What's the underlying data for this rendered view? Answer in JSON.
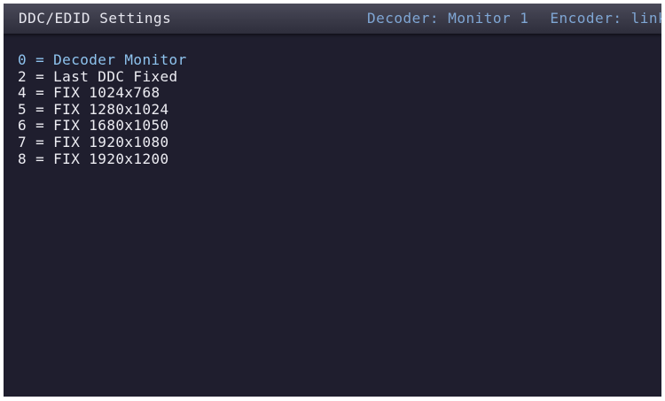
{
  "header": {
    "title": "DDC/EDID Settings",
    "decoder_status": "Decoder: Monitor 1",
    "encoder_status": "Encoder: links"
  },
  "menu": {
    "selected_index": 0,
    "options": [
      {
        "label": "0 = Decoder Monitor"
      },
      {
        "label": "2 = Last DDC Fixed"
      },
      {
        "label": "4 = FIX 1024x768"
      },
      {
        "label": "5 = FIX 1280x1024"
      },
      {
        "label": "6 = FIX 1680x1050"
      },
      {
        "label": "7 = FIX 1920x1080"
      },
      {
        "label": "8 = FIX 1920x1200"
      }
    ]
  },
  "colors": {
    "background": "#1f1e2e",
    "title_bar": "#3a3a48",
    "text": "#ececf2",
    "highlight": "#8ec3ee",
    "status_text": "#7fa6d4"
  }
}
